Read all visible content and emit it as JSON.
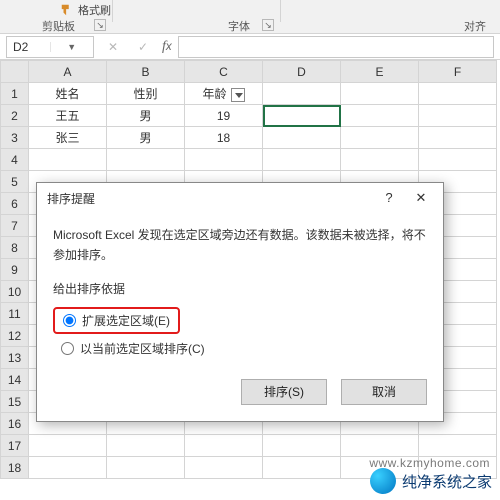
{
  "ribbon": {
    "format_painter": "格式刷",
    "group_clipboard": "剪贴板",
    "group_font": "字体",
    "group_align": "对齐"
  },
  "namebox": {
    "value": "D2"
  },
  "grid": {
    "columns": [
      "A",
      "B",
      "C",
      "D",
      "E",
      "F"
    ],
    "rows": [
      "1",
      "2",
      "3",
      "4",
      "5",
      "6",
      "7",
      "8",
      "9",
      "10",
      "11",
      "12",
      "13",
      "14",
      "15",
      "16",
      "17",
      "18"
    ],
    "header": {
      "A": "姓名",
      "B": "性别",
      "C": "年龄"
    },
    "data": [
      {
        "A": "王五",
        "B": "男",
        "C": "19"
      },
      {
        "A": "张三",
        "B": "男",
        "C": "18"
      }
    ],
    "selected_cell": "D2",
    "filter_on_col": "C"
  },
  "dialog": {
    "title": "排序提醒",
    "help_label": "?",
    "close_label": "✕",
    "message": "Microsoft Excel 发现在选定区域旁边还有数据。该数据未被选择，将不参加排序。",
    "group_label": "给出排序依据",
    "option_expand": "扩展选定区域(E)",
    "option_current": "以当前选定区域排序(C)",
    "selected_option": "expand",
    "sort_btn": "排序(S)",
    "cancel_btn": "取消"
  },
  "watermark": {
    "text": "纯净系统之家",
    "url": "www.kzmyhome.com"
  }
}
